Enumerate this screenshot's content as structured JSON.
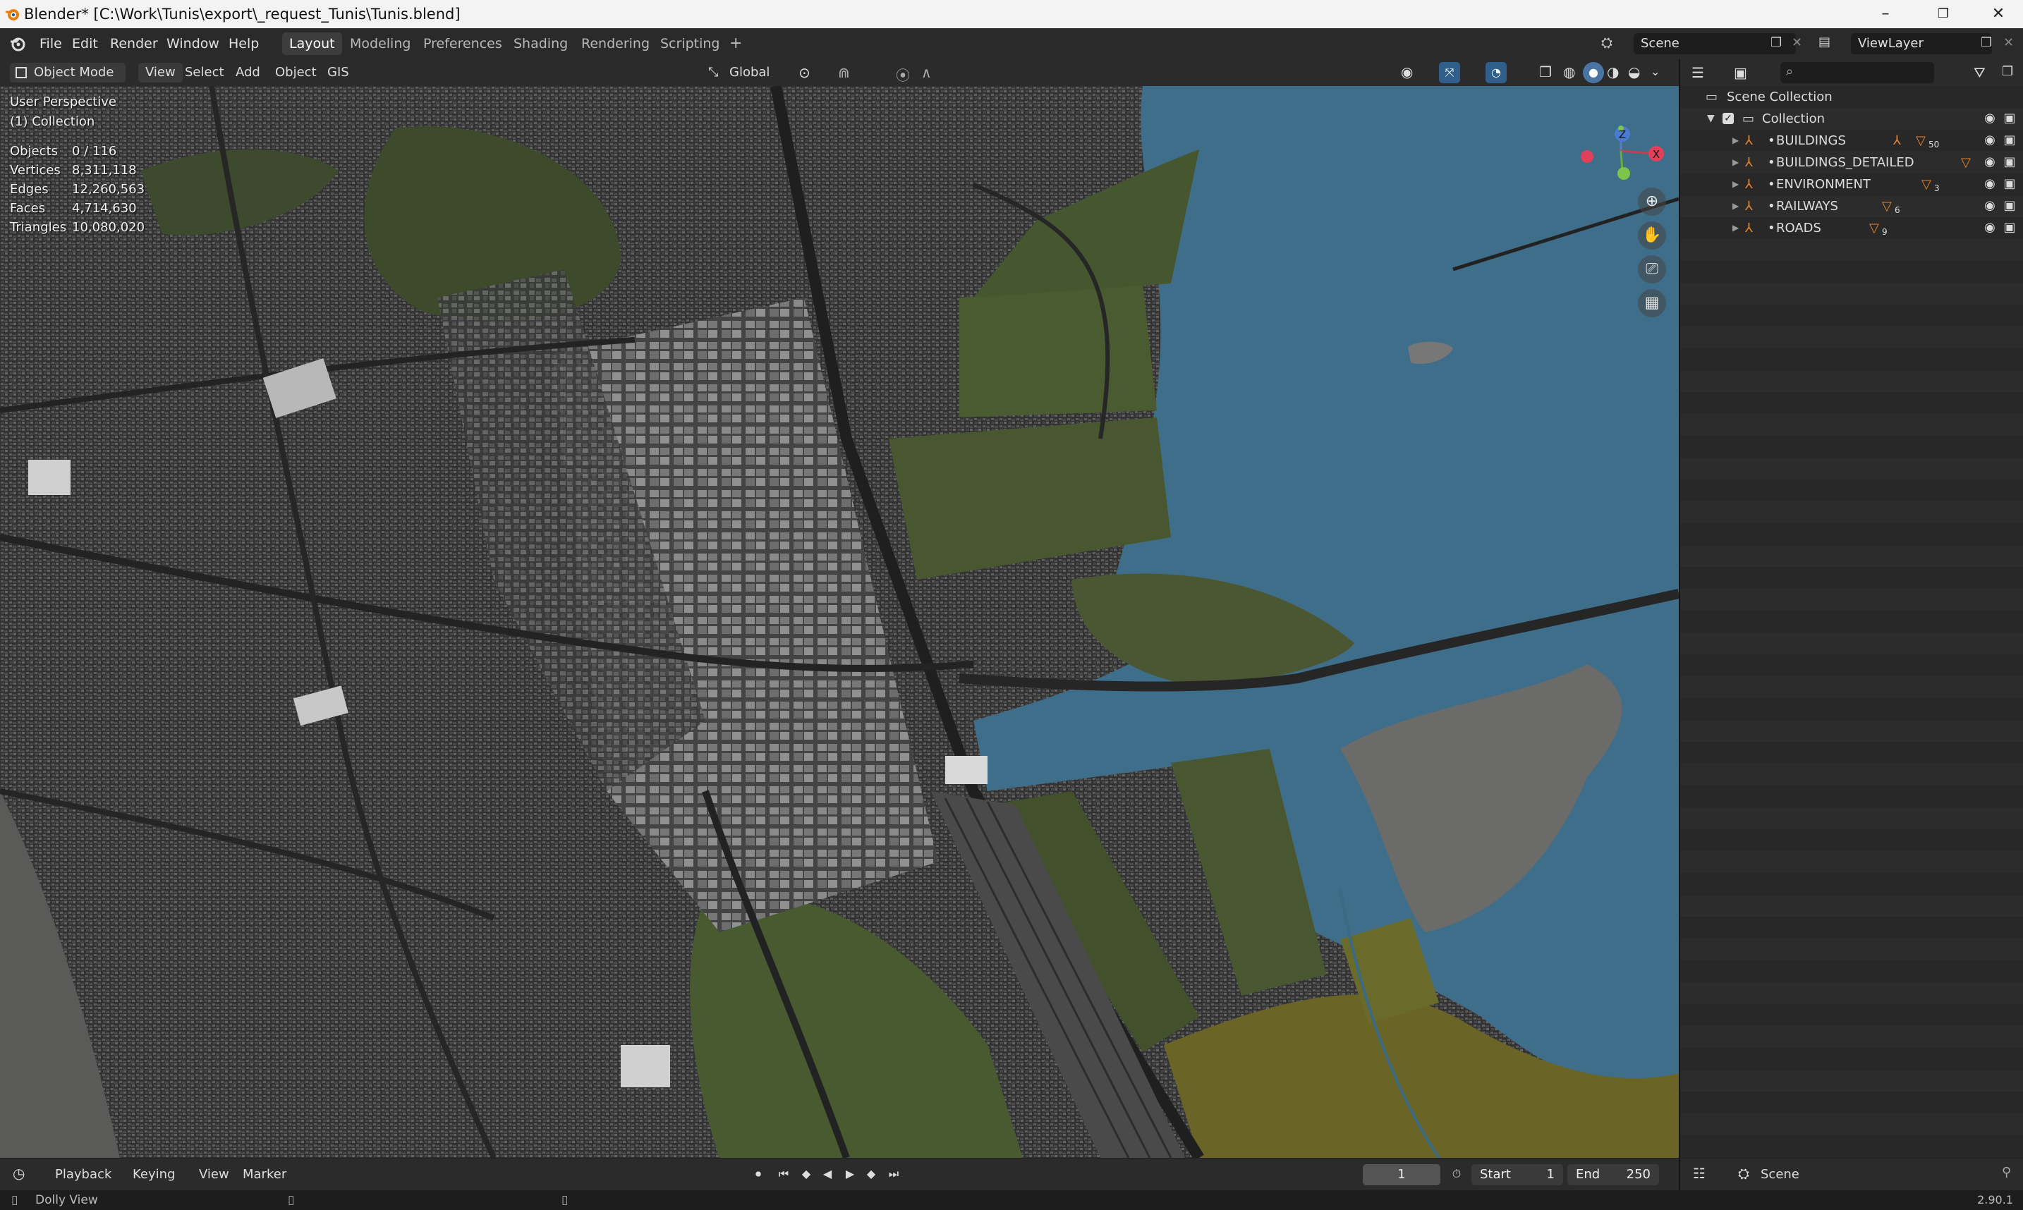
{
  "window": {
    "title": "Blender* [C:\\Work\\Tunis\\export\\_request_Tunis\\Tunis.blend]",
    "minimize": "–",
    "maximize": "❐",
    "close": "✕"
  },
  "menu": [
    "File",
    "Edit",
    "Render",
    "Window",
    "Help"
  ],
  "workspaces": [
    "Layout",
    "Modeling",
    "Preferences",
    "Shading",
    "Rendering",
    "Scripting"
  ],
  "workspace_add": "+",
  "scene": {
    "label": "Scene"
  },
  "view_layer": {
    "label": "ViewLayer"
  },
  "viewport_header": {
    "mode": "Object Mode",
    "menus": [
      "View",
      "Select",
      "Add",
      "Object",
      "GIS"
    ],
    "transform_orientation": "Global"
  },
  "viewport_overlay": {
    "view_name": "User Perspective",
    "collection": "(1) Collection",
    "stats": [
      {
        "label": "Objects",
        "value": "0 / 116"
      },
      {
        "label": "Vertices",
        "value": "8,311,118"
      },
      {
        "label": "Edges",
        "value": "12,260,563"
      },
      {
        "label": "Faces",
        "value": "4,714,630"
      },
      {
        "label": "Triangles",
        "value": "10,080,020"
      }
    ]
  },
  "gizmo": {
    "z": "Z",
    "x": "X",
    "y": "Y"
  },
  "outliner": {
    "root": "Scene Collection",
    "collection": "Collection",
    "items": [
      {
        "name": "BUILDINGS",
        "badge": "50"
      },
      {
        "name": "BUILDINGS_DETAILED",
        "badge": ""
      },
      {
        "name": "ENVIRONMENT",
        "badge": "3"
      },
      {
        "name": "RAILWAYS",
        "badge": "6"
      },
      {
        "name": "ROADS",
        "badge": "9"
      }
    ]
  },
  "timeline": {
    "menus": [
      "Playback",
      "Keying",
      "View",
      "Marker"
    ],
    "current_frame": "1",
    "start_label": "Start",
    "start": "1",
    "end_label": "End",
    "end": "250"
  },
  "properties_bar": {
    "scene": "Scene"
  },
  "status": {
    "left": "Dolly View",
    "version": "2.90.1"
  },
  "colors": {
    "water": "#3f6e8a",
    "land": "#4a5a32",
    "city": "#3c3c3c",
    "accent_orange": "#e8842a"
  }
}
